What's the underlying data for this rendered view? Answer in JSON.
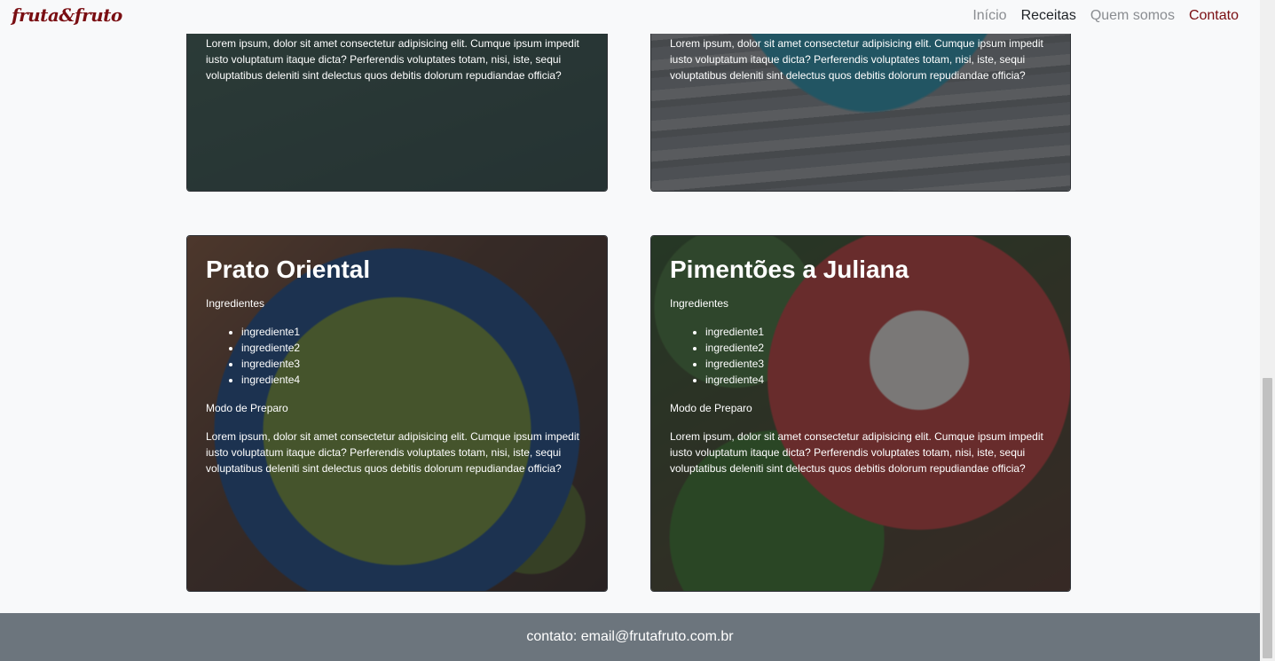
{
  "navbar": {
    "brand": "fruta&fruto",
    "links": [
      "Início",
      "Receitas",
      "Quem somos",
      "Contato"
    ]
  },
  "cards": {
    "top_left": {
      "text": "Lorem ipsum, dolor sit amet consectetur adipisicing elit. Cumque ipsum impedit iusto voluptatum itaque dicta? Perferendis voluptates totam, nisi, iste, sequi voluptatibus deleniti sint delectus quos debitis dolorum repudiandae officia?"
    },
    "top_right": {
      "text": "Lorem ipsum, dolor sit amet consectetur adipisicing elit. Cumque ipsum impedit iusto voluptatum itaque dicta? Perferendis voluptates totam, nisi, iste, sequi voluptatibus deleniti sint delectus quos debitis dolorum repudiandae officia?"
    },
    "bottom_left": {
      "title": "Prato Oriental",
      "ingredients_label": "Ingredientes",
      "ingredients": [
        "ingrediente1",
        "ingrediente2",
        "ingrediente3",
        "ingrediente4"
      ],
      "method_label": "Modo de Preparo",
      "text": "Lorem ipsum, dolor sit amet consectetur adipisicing elit. Cumque ipsum impedit iusto voluptatum itaque dicta? Perferendis voluptates totam, nisi, iste, sequi voluptatibus deleniti sint delectus quos debitis dolorum repudiandae officia?"
    },
    "bottom_right": {
      "title": "Pimentões a Juliana",
      "ingredients_label": "Ingredientes",
      "ingredients": [
        "ingrediente1",
        "ingrediente2",
        "ingrediente3",
        "ingrediente4"
      ],
      "method_label": "Modo de Preparo",
      "text": "Lorem ipsum, dolor sit amet consectetur adipisicing elit. Cumque ipsum impedit iusto voluptatum itaque dicta? Perferendis voluptates totam, nisi, iste, sequi voluptatibus deleniti sint delectus quos debitis dolorum repudiandae officia?"
    }
  },
  "footer": {
    "contact": "contato: email@frutafruto.com.br"
  },
  "colors": {
    "brand": "#7a0e12",
    "footer_bg": "#6c757d",
    "page_bg": "#f8f9fa"
  }
}
